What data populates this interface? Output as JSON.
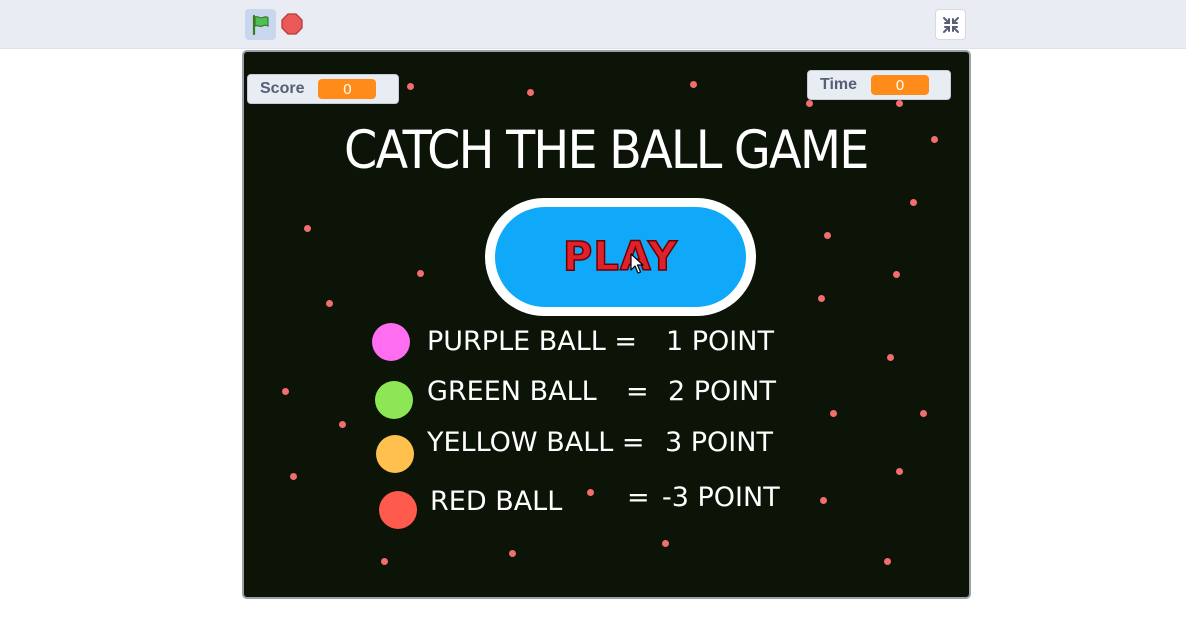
{
  "toolbar": {
    "green_flag_icon": "green-flag-icon",
    "stop_icon": "stop-icon",
    "fullscreen_icon": "exit-fullscreen-icon"
  },
  "stage": {
    "score_monitor": {
      "label": "Score",
      "value": "0"
    },
    "time_monitor": {
      "label": "Time",
      "value": "0"
    },
    "title": "CATCH THE BALL GAME",
    "play_button": {
      "label": "PLAY"
    },
    "rules": [
      {
        "ball": "PURPLE BALL =",
        "points": "1 POINT",
        "color": "#ff6ef0"
      },
      {
        "ball": "GREEN BALL",
        "equals": "=",
        "points": "2 POINT",
        "color": "#8de653"
      },
      {
        "ball": "YELLOW BALL =",
        "points": "3 POINT",
        "color": "#ffc04d"
      },
      {
        "ball": "RED BALL",
        "equals": "=",
        "points": "-3 POINT",
        "color": "#ff5a4e"
      }
    ]
  },
  "colors": {
    "stage_background": "#0c1408",
    "monitor_value": "#ff8c1a",
    "play_button": "#10a8f8",
    "play_text": "#e0202a",
    "dots": "#f26d6d"
  }
}
